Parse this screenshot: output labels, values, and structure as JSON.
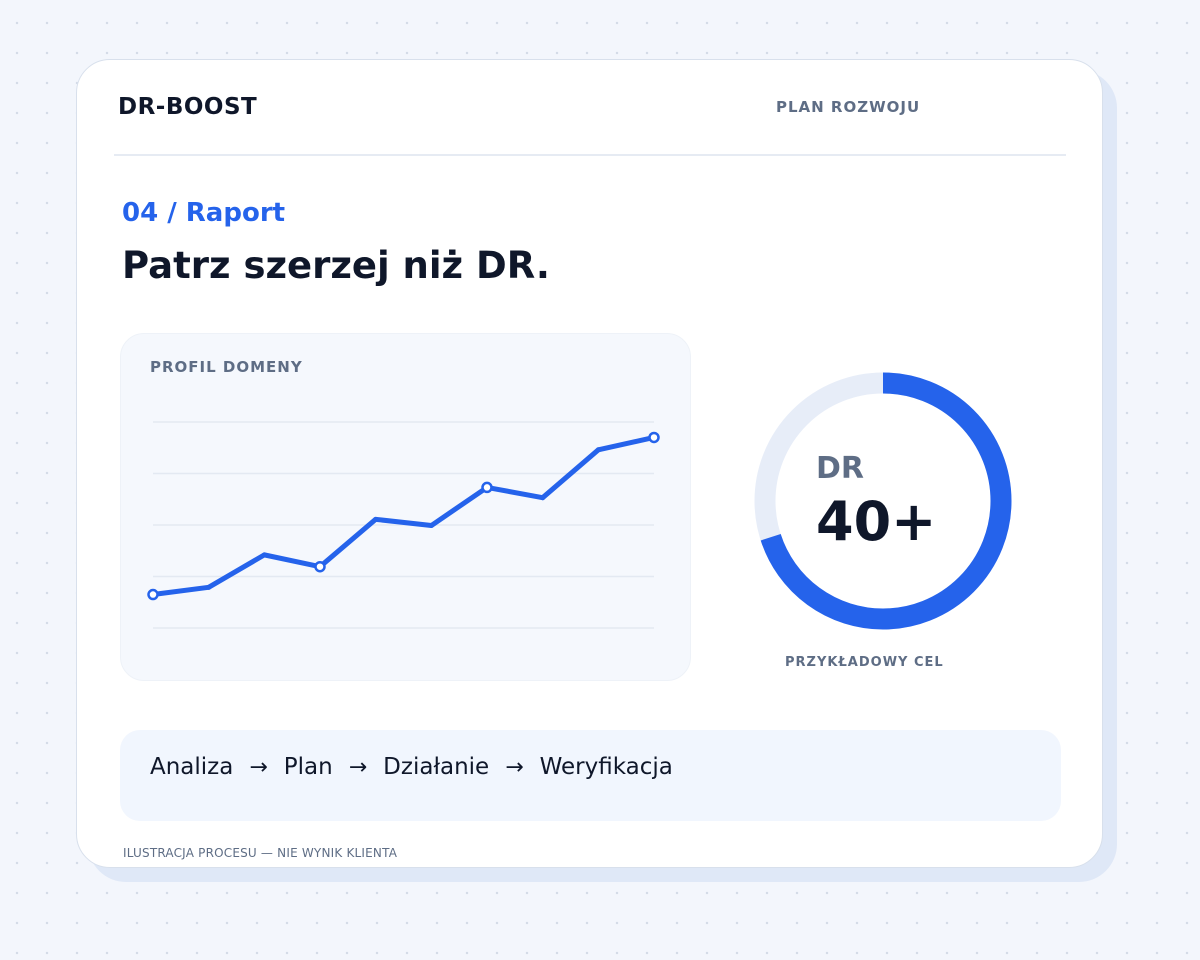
{
  "header": {
    "brand": "DR-BOOST",
    "nav_link": "PLAN ROZWOJU"
  },
  "hero": {
    "eyebrow": "04 / Raport",
    "headline": "Patrz szerzej niż DR."
  },
  "chart_data": [
    {
      "type": "line",
      "title": "PROFIL DOMENY",
      "xlabel": "",
      "ylabel": "",
      "x": [
        1,
        2,
        3,
        4,
        5,
        6,
        7,
        8,
        9,
        10
      ],
      "series": [
        {
          "values": [
            6.5,
            7.9,
            14.2,
            11.9,
            21.1,
            19.9,
            27.3,
            25.3,
            34.6,
            37.0
          ],
          "color": "#2563eb",
          "highlighted_points": [
            0,
            3,
            6,
            9
          ]
        }
      ],
      "ylim": [
        0,
        40
      ],
      "grid": true,
      "gridline_values": [
        0,
        10,
        20,
        30,
        40
      ],
      "show_axes": false
    },
    {
      "type": "pie",
      "subtype": "donut",
      "label": "DR",
      "value_text": "40+",
      "caption": "PRZYKŁADOWY CEL",
      "fill_fraction": 0.7,
      "colors": {
        "fill": "#2563eb",
        "track": "#e7edf8"
      }
    }
  ],
  "process": {
    "steps": [
      "Analiza",
      "Plan",
      "Działanie",
      "Weryfikacja"
    ],
    "separator": "→"
  },
  "footer": {
    "note": "ILUSTRACJA PROCESU — NIE WYNIK KLIENTA"
  },
  "colors": {
    "accent": "#2563eb",
    "text_dark": "#0f172a",
    "text_muted": "#5e6d85",
    "page_background": "#f3f6fc",
    "card_background": "#ffffff"
  }
}
